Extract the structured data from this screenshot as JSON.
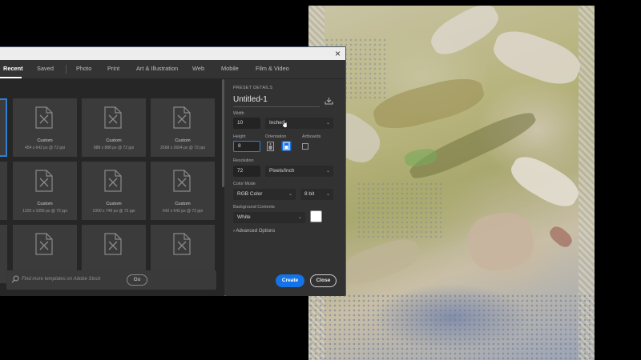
{
  "tabs": [
    {
      "label": "Recent",
      "active": true
    },
    {
      "label": "Saved"
    },
    {
      "label": "Photo"
    },
    {
      "label": "Print"
    },
    {
      "label": "Art & Illustration"
    },
    {
      "label": "Web"
    },
    {
      "label": "Mobile"
    },
    {
      "label": "Film & Video"
    }
  ],
  "close_glyph": "×",
  "presets": [
    {
      "title": "",
      "sub": ""
    },
    {
      "title": "Custom",
      "sub": "454 x 642 px @ 72 ppi"
    },
    {
      "title": "Custom",
      "sub": "888 x 888 px @ 72 ppi"
    },
    {
      "title": "Custom",
      "sub": "2568 x 2604 px @ 72 ppi"
    },
    {
      "title": "",
      "sub": ""
    },
    {
      "title": "Custom",
      "sub": "1320 x 1056 px @ 72 ppi"
    },
    {
      "title": "Custom",
      "sub": "1000 x 749 px @ 72 ppi"
    },
    {
      "title": "Custom",
      "sub": "642 x 642 px @ 72 ppi"
    }
  ],
  "search": {
    "placeholder": "Find more templates on Adobe Stock",
    "go_label": "Go"
  },
  "preset_details": {
    "header": "PRESET DETAILS",
    "name": "Untitled-1",
    "width_label": "Width",
    "width_value": "10",
    "width_unit": "Inches",
    "height_label": "Height",
    "height_value": "8",
    "orientation_label": "Orientation",
    "artboards_label": "Artboards",
    "resolution_label": "Resolution",
    "resolution_value": "72",
    "resolution_unit": "Pixels/Inch",
    "color_mode_label": "Color Mode",
    "color_mode_value": "RGB Color",
    "bit_depth": "8 bit",
    "background_label": "Background Contents",
    "background_value": "White",
    "advanced_label": "Advanced Options"
  },
  "buttons": {
    "create": "Create",
    "close": "Close"
  },
  "colors": {
    "accent": "#1473e6",
    "selection": "#2f7fd4"
  },
  "icons": {
    "doc": "document-icon",
    "search": "search-icon"
  }
}
